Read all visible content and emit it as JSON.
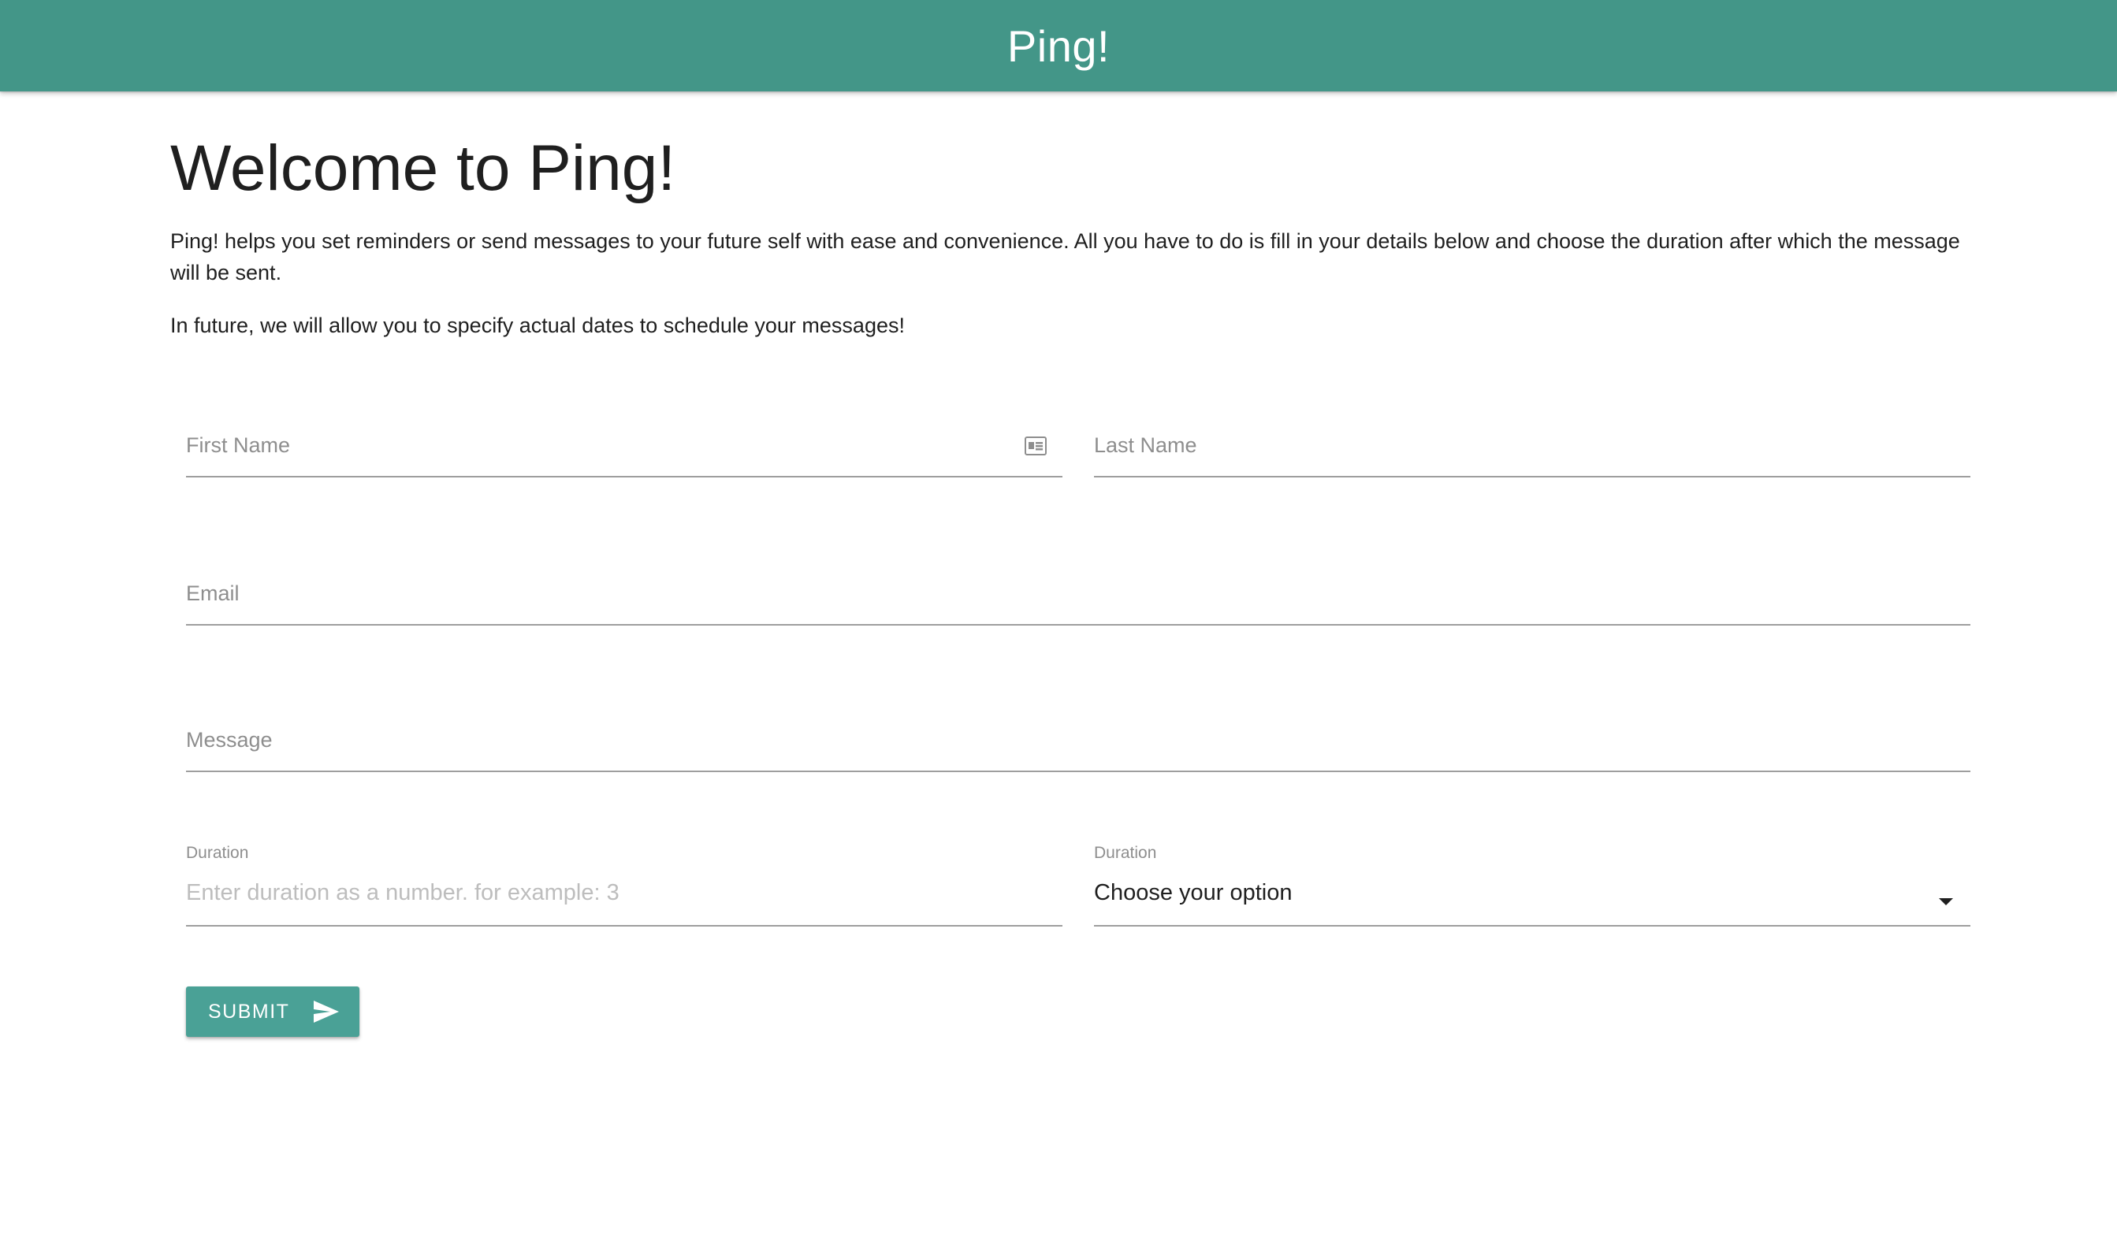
{
  "navbar": {
    "brand": "Ping!",
    "color": "#439688"
  },
  "main": {
    "heading": "Welcome to Ping!",
    "intro": "Ping! helps you set reminders or send messages to your future self with ease and convenience. All you have to do is fill in your details below and choose the duration after which the message will be sent.",
    "note": "In future, we will allow you to specify actual dates to schedule your messages!"
  },
  "form": {
    "first_name": {
      "placeholder": "First Name",
      "icon": "contact-card-icon"
    },
    "last_name": {
      "placeholder": "Last Name"
    },
    "email": {
      "placeholder": "Email"
    },
    "message": {
      "placeholder": "Message"
    },
    "duration_number": {
      "label": "Duration",
      "placeholder": "Enter duration as a number. for example: 3"
    },
    "duration_unit": {
      "label": "Duration",
      "selected": "Choose your option",
      "icon": "caret-down-icon"
    },
    "submit": {
      "label": "SUBMIT",
      "icon": "send-icon",
      "color": "#4aa196"
    }
  }
}
